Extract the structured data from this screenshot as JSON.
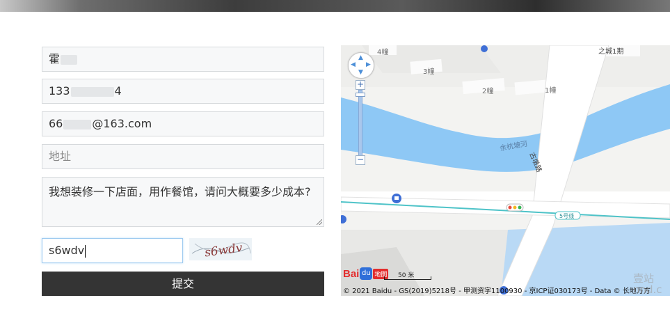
{
  "form": {
    "name_value": "霍",
    "phone_prefix": "133",
    "phone_suffix": "4",
    "email_prefix": "66",
    "email_suffix": "@163.com",
    "address_placeholder": "地址",
    "message_value": "我想装修一下店面，用作餐馆，请问大概要多少成本?",
    "captcha_value": "s6wdv",
    "captcha_image_text": "s6wdv",
    "submit_label": "提交"
  },
  "map": {
    "labels": {
      "bldg4": "4幢",
      "bldg3": "3幢",
      "bldg2": "2幢",
      "bldg1": "1幢",
      "city": "之城1期",
      "river": "余杭塘河",
      "road": "古墩路",
      "metro_line": "5号线"
    },
    "zoom_in": "+",
    "zoom_out": "−",
    "logo_bai": "Bai",
    "logo_paw": "du",
    "logo_map": "地图",
    "scale_label": "50 米",
    "copyright": "© 2021 Baidu - GS(2019)5218号 - 甲测资字1100930 - 京ICP证030173号 - Data © 长地万方",
    "colors": {
      "water": "#8ec8f5",
      "metro": "#4ec3c8",
      "road": "#ffffff",
      "poi": "#3f6fd6"
    }
  },
  "watermark": "壹站\nnnd.c"
}
